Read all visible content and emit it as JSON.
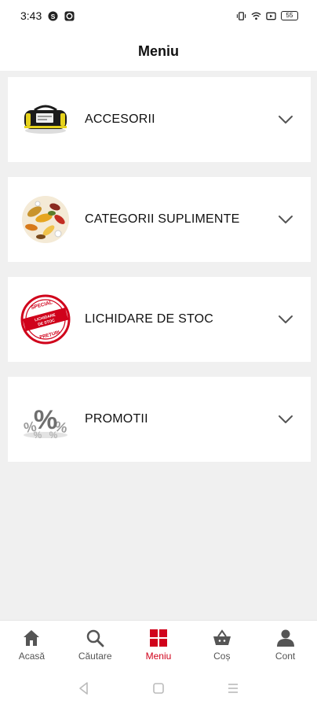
{
  "status_bar": {
    "time": "3:43",
    "battery": "55",
    "left_icons": [
      "notification-s-icon",
      "shazam-icon"
    ],
    "right_icons": [
      "vibrate-icon",
      "wifi-icon",
      "cast-icon",
      "battery-icon"
    ]
  },
  "header": {
    "title": "Meniu"
  },
  "menu": {
    "items": [
      {
        "label": "ACCESORII",
        "icon": "gym-bag-image"
      },
      {
        "label": "CATEGORII SUPLIMENTE",
        "icon": "pills-image"
      },
      {
        "label": "LICHIDARE DE STOC",
        "icon": "special-stamp-image",
        "stamp_top": "SPECIAL",
        "stamp_middle": "LICHIDARE DE STOC",
        "stamp_bottom": "PREȚURI"
      },
      {
        "label": "PROMOTII",
        "icon": "percent-image"
      }
    ]
  },
  "bottom_nav": {
    "items": [
      {
        "label": "Acasă",
        "icon": "home-icon"
      },
      {
        "label": "Căutare",
        "icon": "search-icon"
      },
      {
        "label": "Meniu",
        "icon": "grid-icon"
      },
      {
        "label": "Coș",
        "icon": "basket-icon"
      },
      {
        "label": "Cont",
        "icon": "user-icon"
      }
    ],
    "active_index": 2
  },
  "colors": {
    "accent": "#d0021b",
    "background": "#f0f0f0",
    "card": "#ffffff",
    "text": "#111111"
  },
  "system_nav": {
    "buttons": [
      "back-icon",
      "home-square-icon",
      "recents-icon"
    ]
  }
}
